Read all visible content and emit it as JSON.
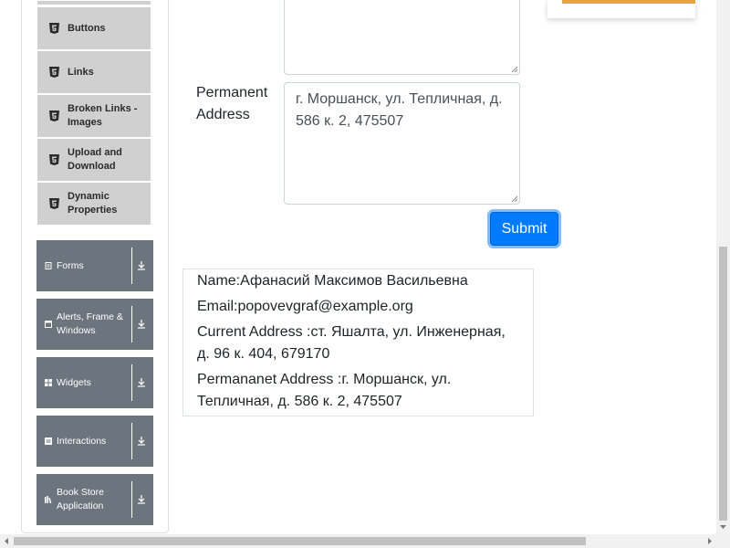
{
  "sidebar": {
    "elements_items": [
      {
        "label": "Buttons",
        "icon": "html5-icon"
      },
      {
        "label": "Links",
        "icon": "html5-icon"
      },
      {
        "label": "Broken Links - Images",
        "icon": "html5-icon"
      },
      {
        "label": "Upload and Download",
        "icon": "html5-icon"
      },
      {
        "label": "Dynamic Properties",
        "icon": "html5-icon"
      }
    ],
    "groups": [
      {
        "label": "Forms",
        "icon": "file-icon"
      },
      {
        "label": "Alerts, Frame & Windows",
        "icon": "window-icon"
      },
      {
        "label": "Widgets",
        "icon": "grid-icon"
      },
      {
        "label": "Interactions",
        "icon": "list-icon"
      },
      {
        "label": "Book Store Application",
        "icon": "books-icon"
      }
    ]
  },
  "form": {
    "permanent_address_label": "Permanent Address",
    "current_address_value": "",
    "permanent_address_value": "г. Моршанск, ул. Тепличная, д. 586 к. 2, 475507",
    "submit_label": "Submit"
  },
  "output": {
    "name": "Name:Афанасий Максимов Васильевна",
    "email": "Email:popovevgraf@example.org",
    "current_address": "Current Address :ст. Яшалта, ул. Инженерная, д. 96 к. 404, 679170",
    "permanent_address": "Permananet Address :г. Моршанск, ул. Тепличная, д. 586 к. 2, 475507"
  },
  "colors": {
    "primary": "#007bff",
    "sidebar_group": "#6c757d",
    "sidebar_item": "#d0d0d0",
    "ad_accent": "#e8a33d"
  }
}
